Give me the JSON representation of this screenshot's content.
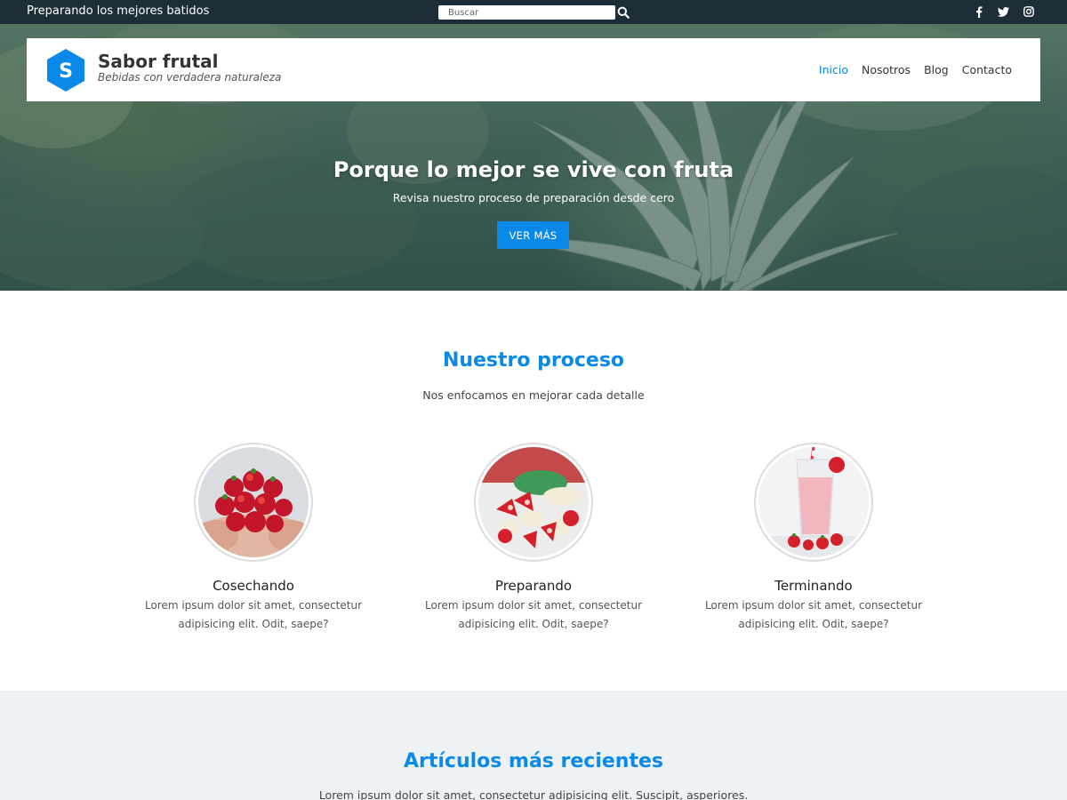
{
  "topbar": {
    "tagline": "Preparando los mejores batidos",
    "search_placeholder": "Buscar",
    "icons": [
      "search-icon",
      "facebook-icon",
      "twitter-icon",
      "instagram-icon"
    ]
  },
  "header": {
    "logo_letter": "S",
    "brand": "Sabor frutal",
    "slogan": "Bebidas con verdadera naturaleza",
    "nav": [
      {
        "label": "Inicio",
        "active": true
      },
      {
        "label": "Nosotros",
        "active": false
      },
      {
        "label": "Blog",
        "active": false
      },
      {
        "label": "Contacto",
        "active": false
      }
    ]
  },
  "hero": {
    "title": "Porque lo mejor se vive con fruta",
    "subtitle": "Revisa nuestro proceso de preparación desde cero",
    "button": "VER MÁS"
  },
  "process": {
    "title": "Nuestro proceso",
    "subtitle": "Nos enfocamos en mejorar cada detalle",
    "steps": [
      {
        "title": "Cosechando",
        "text": "Lorem ipsum dolor sit amet, consectetur adipisicing elit. Odit, saepe?"
      },
      {
        "title": "Preparando",
        "text": "Lorem ipsum dolor sit amet, consectetur adipisicing elit. Odit, saepe?"
      },
      {
        "title": "Terminando",
        "text": "Lorem ipsum dolor sit amet, consectetur adipisicing elit. Odit, saepe?"
      }
    ]
  },
  "articles": {
    "title": "Artículos más recientes",
    "subtitle": "Lorem ipsum dolor sit amet, consectetur adipisicing elit. Suscipit, asperiores."
  },
  "colors": {
    "accent": "#0a8ae8",
    "topbar": "#1d2e38",
    "section_bg": "#eef2f5"
  }
}
